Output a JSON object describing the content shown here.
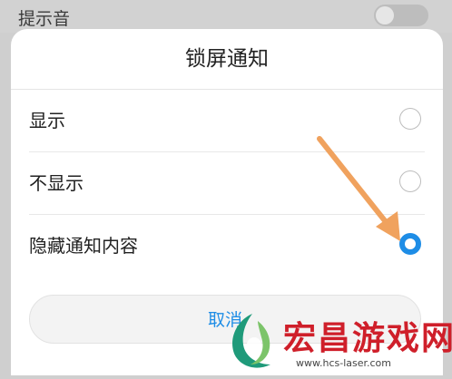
{
  "background": {
    "setting_label": "提示音"
  },
  "dialog": {
    "title": "锁屏通知",
    "options": [
      {
        "label": "显示",
        "selected": false
      },
      {
        "label": "不显示",
        "selected": false
      },
      {
        "label": "隐藏通知内容",
        "selected": true
      }
    ],
    "cancel_label": "取消"
  },
  "watermark": {
    "text": "宏昌游戏网",
    "url": "www.hcs-laser.com"
  },
  "colors": {
    "accent": "#1e8de6",
    "arrow": "#f0a25e",
    "watermark_red": "#cf1f2a"
  }
}
